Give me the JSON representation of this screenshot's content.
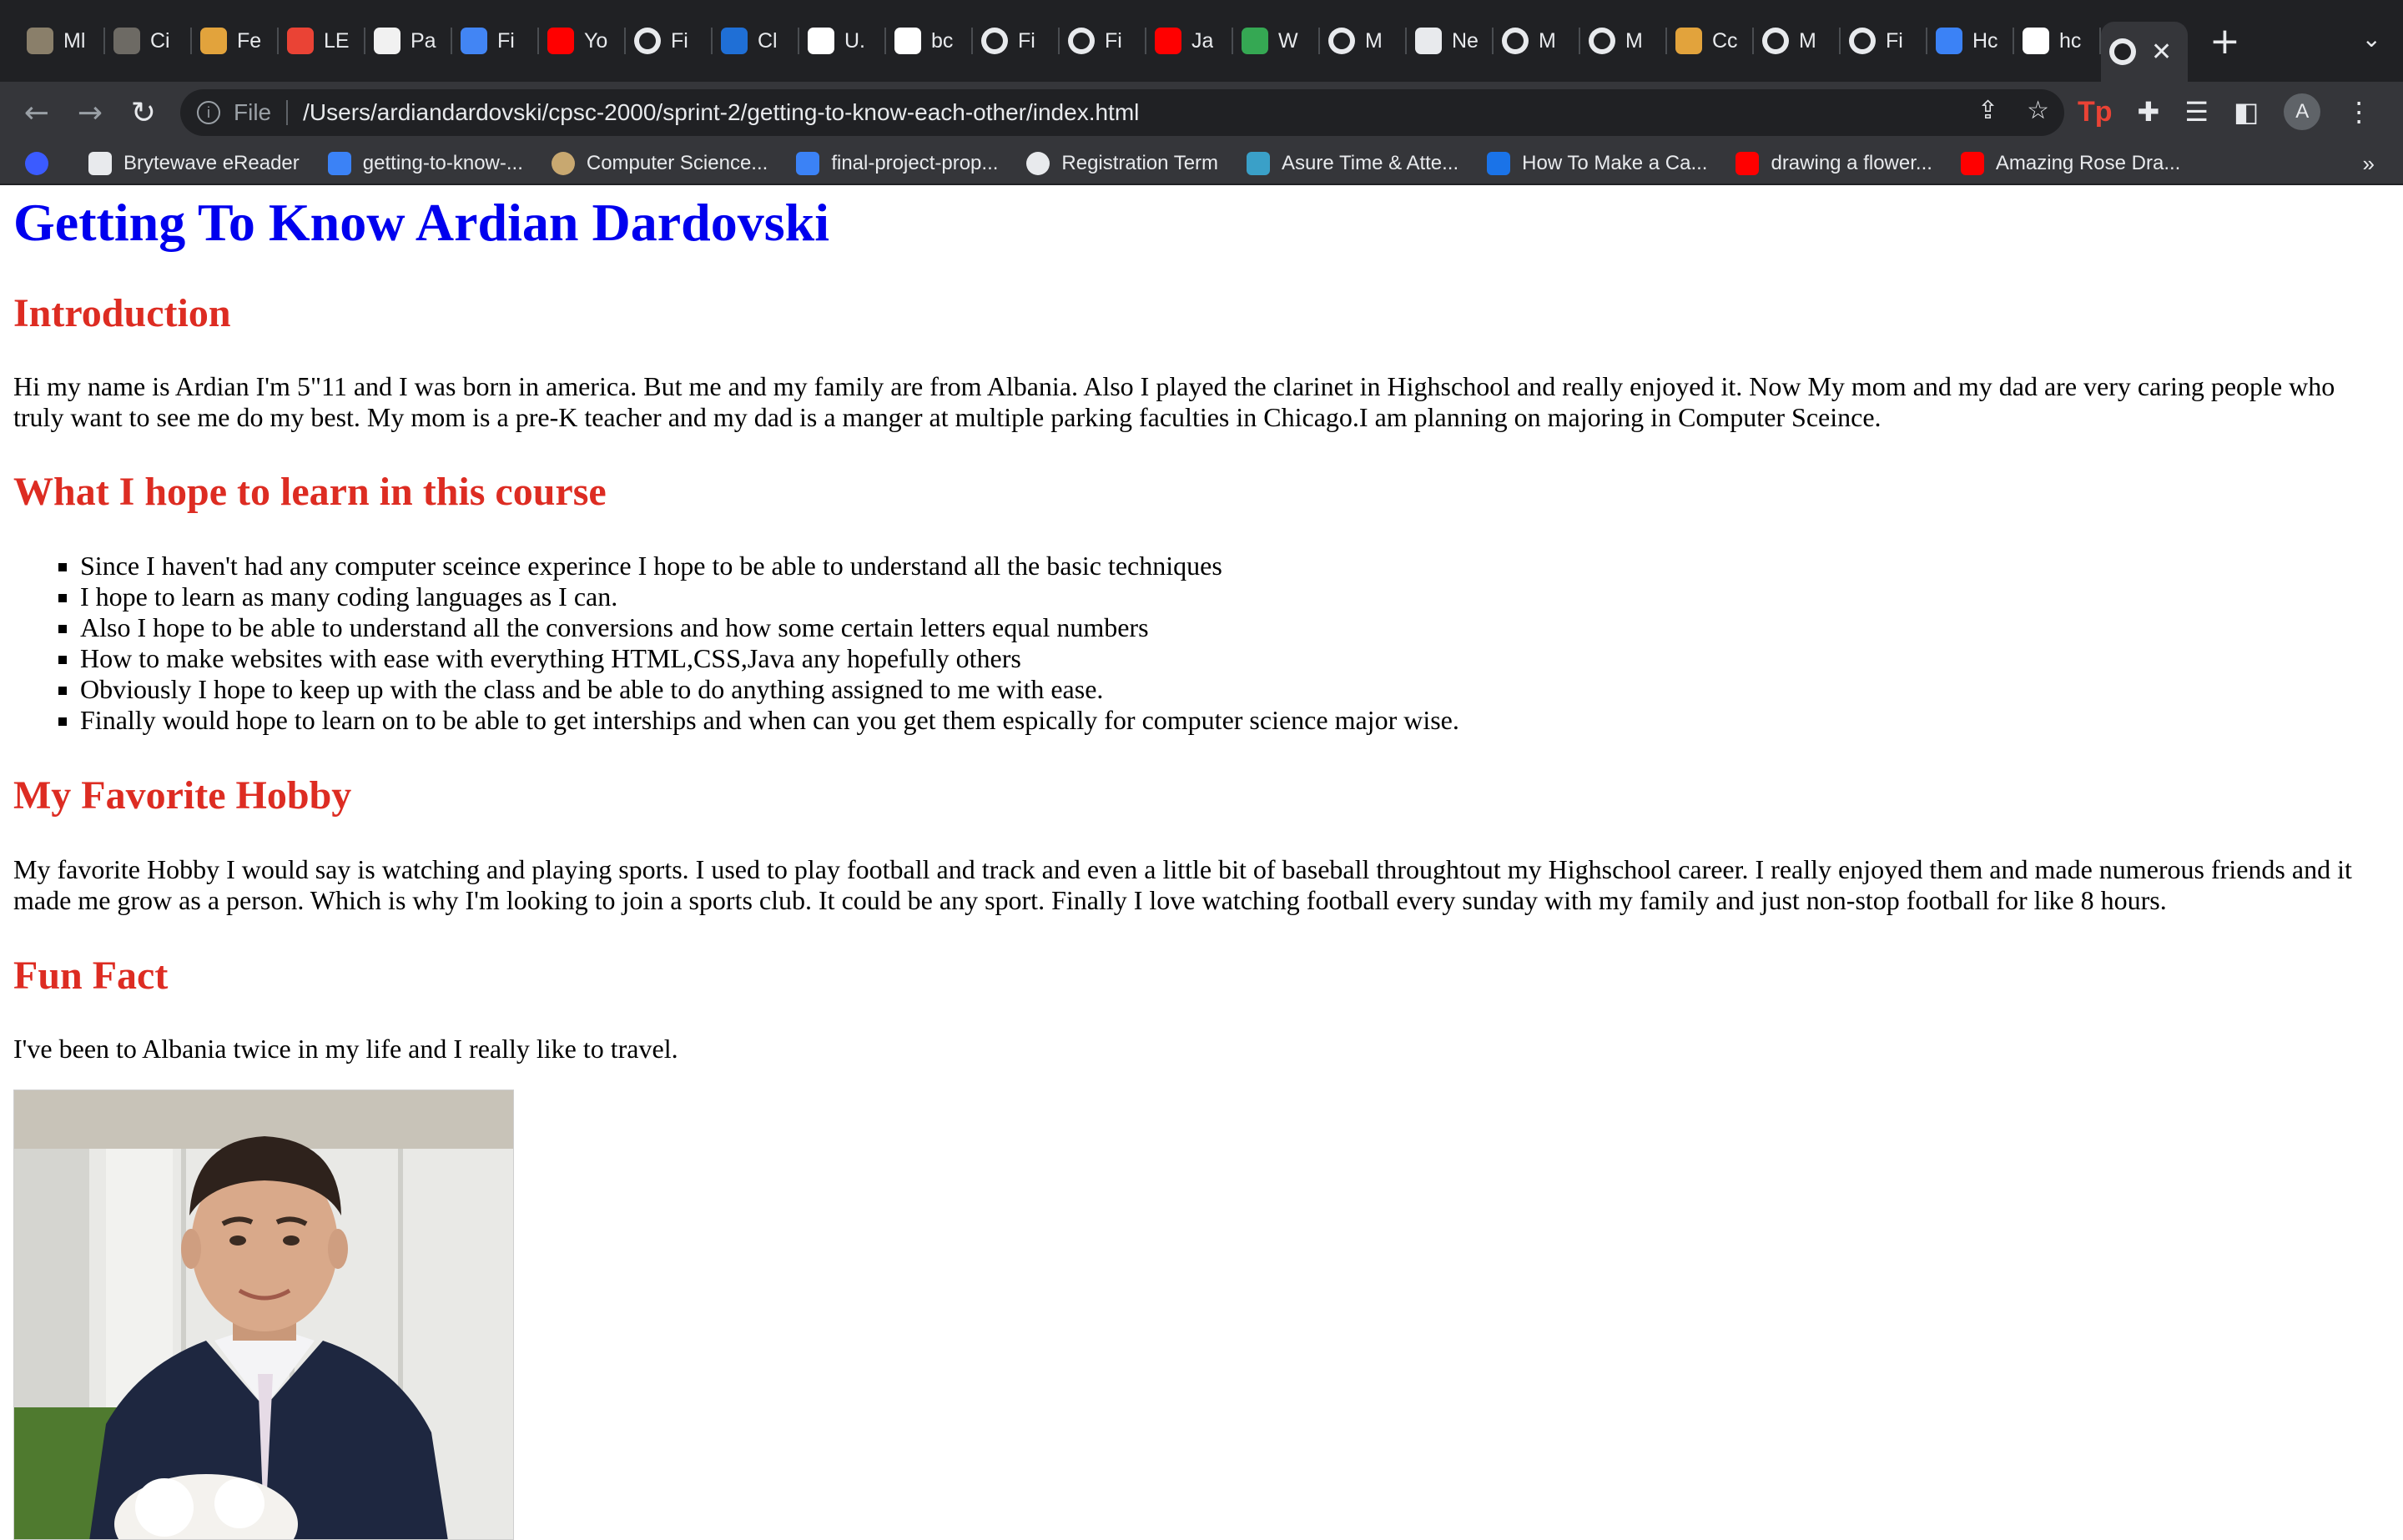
{
  "browser": {
    "tabs": [
      {
        "title": "Ml",
        "icon": "mascot-icon",
        "color": "#8a7f6a"
      },
      {
        "title": "Ci",
        "icon": "university-icon",
        "color": "#6d6a64"
      },
      {
        "title": "Fe",
        "icon": "pencil-icon",
        "color": "#e2a33c"
      },
      {
        "title": "LE",
        "icon": "gmail-icon",
        "color": "#ea4335"
      },
      {
        "title": "Pa",
        "icon": "circle-n-icon",
        "color": "#f1f1f1"
      },
      {
        "title": "Fi",
        "icon": "docs-icon",
        "color": "#4285f4"
      },
      {
        "title": "Yo",
        "icon": "youtube-icon",
        "color": "#ff0000"
      },
      {
        "title": "Fi",
        "icon": "globe-icon",
        "color": "#e8eaed"
      },
      {
        "title": "Cl",
        "icon": "noaa-icon",
        "color": "#1f6fd6"
      },
      {
        "title": "U.",
        "icon": "sa-icon",
        "color": "#ffffff"
      },
      {
        "title": "bc",
        "icon": "google-icon",
        "color": "#ffffff"
      },
      {
        "title": "Fi",
        "icon": "globe-icon",
        "color": "#e8eaed"
      },
      {
        "title": "Fi",
        "icon": "globe-icon",
        "color": "#e8eaed"
      },
      {
        "title": "Ja",
        "icon": "youtube-icon",
        "color": "#ff0000"
      },
      {
        "title": "W",
        "icon": "w-icon",
        "color": "#35a853"
      },
      {
        "title": "M",
        "icon": "globe-icon",
        "color": "#e8eaed"
      },
      {
        "title": "Ne",
        "icon": "chrome-icon",
        "color": "#e8eaed"
      },
      {
        "title": "M",
        "icon": "globe-icon",
        "color": "#e8eaed"
      },
      {
        "title": "M",
        "icon": "globe-icon",
        "color": "#e8eaed"
      },
      {
        "title": "Cc",
        "icon": "pencil-icon",
        "color": "#e2a33c"
      },
      {
        "title": "M",
        "icon": "globe-icon",
        "color": "#e8eaed"
      },
      {
        "title": "Fi",
        "icon": "globe-icon",
        "color": "#e8eaed"
      },
      {
        "title": "Hc",
        "icon": "azure-icon",
        "color": "#3b82f6"
      },
      {
        "title": "hc",
        "icon": "google-icon",
        "color": "#ffffff"
      }
    ],
    "active_tab_icon": "globe-icon",
    "new_tab_label": "+",
    "url_scheme": "File",
    "url": "/Users/ardiandardovski/cpsc-2000/sprint-2/getting-to-know-each-other/index.html",
    "profile_initial": "A",
    "bookmarks": [
      {
        "label": "",
        "icon": "search-icon",
        "color": "#3b5bff"
      },
      {
        "label": "Brytewave eReader",
        "icon": "book-icon",
        "color": "#e8eaed"
      },
      {
        "label": "getting-to-know-...",
        "icon": "azure-icon",
        "color": "#3b82f6"
      },
      {
        "label": "Computer Science...",
        "icon": "globe-icon",
        "color": "#c8a870"
      },
      {
        "label": "final-project-prop...",
        "icon": "azure-icon",
        "color": "#3b82f6"
      },
      {
        "label": "Registration Term",
        "icon": "globe-icon",
        "color": "#e8eaed"
      },
      {
        "label": "Asure Time & Atte...",
        "icon": "asure-icon",
        "color": "#3aa0c8"
      },
      {
        "label": "How To Make a Ca...",
        "icon": "digitalocean-icon",
        "color": "#1a73e8"
      },
      {
        "label": "drawing a flower...",
        "icon": "youtube-icon",
        "color": "#ff0000"
      },
      {
        "label": "Amazing Rose Dra...",
        "icon": "youtube-icon",
        "color": "#ff0000"
      }
    ],
    "bookmarks_overflow": "»"
  },
  "page": {
    "title": "Getting To Know Ardian Dardovski",
    "introduction": {
      "heading": "Introduction",
      "text": "Hi my name is Ardian I'm 5\"11 and I was born in america. But me and my family are from Albania. Also I played the clarinet in Highschool and really enjoyed it. Now My mom and my dad are very caring people who truly want to see me do my best. My mom is a pre-K teacher and my dad is a manger at multiple parking faculties in Chicago.I am planning on majoring in Computer Sceince."
    },
    "learn": {
      "heading": "What I hope to learn in this course",
      "items": [
        "Since I haven't had any computer sceince experince I hope to be able to understand all the basic techniques",
        "I hope to learn as many coding languages as I can.",
        "Also I hope to be able to understand all the conversions and how some certain letters equal numbers",
        "How to make websites with ease with everything HTML,CSS,Java any hopefully others",
        "Obviously I hope to keep up with the class and be able to do anything assigned to me with ease.",
        "Finally would hope to learn on to be able to get interships and when can you get them espically for computer science major wise."
      ]
    },
    "hobby": {
      "heading": "My Favorite Hobby",
      "text": "My favorite Hobby I would say is watching and playing sports. I used to play football and track and even a little bit of baseball throughtout my Highschool career. I really enjoyed them and made numerous friends and it made me grow as a person. Which is why I'm looking to join a sports club. It could be any sport. Finally I love watching football every sunday with my family and just non-stop football for like 8 hours."
    },
    "fun_fact": {
      "heading": "Fun Fact",
      "text": "I've been to Albania twice in my life and I really like to travel."
    }
  },
  "colors": {
    "title": "#0000ee",
    "heading": "#dd2c22",
    "chrome_dark": "#202124",
    "chrome_toolbar": "#35363a"
  }
}
